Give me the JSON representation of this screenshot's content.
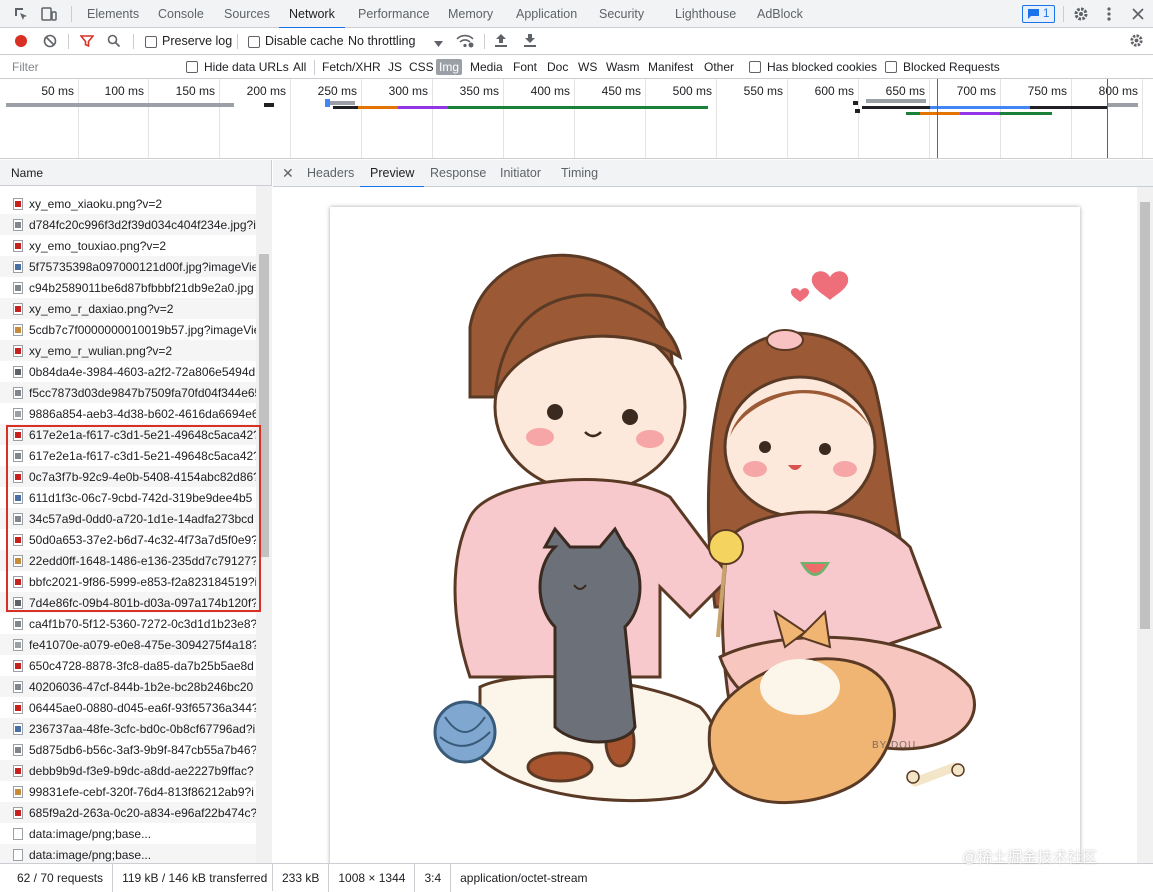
{
  "main_tabs": [
    "Elements",
    "Console",
    "Sources",
    "Network",
    "Performance",
    "Memory",
    "Application",
    "Security",
    "Lighthouse",
    "AdBlock"
  ],
  "active_main_tab": "Network",
  "message_count": "1",
  "toolbar": {
    "preserve_log": "Preserve log",
    "disable_cache": "Disable cache",
    "throttling": "No throttling"
  },
  "filter": {
    "placeholder": "Filter",
    "hide_data_urls": "Hide data URLs",
    "types": [
      "All",
      "Fetch/XHR",
      "JS",
      "CSS",
      "Img",
      "Media",
      "Font",
      "Doc",
      "WS",
      "Wasm",
      "Manifest",
      "Other"
    ],
    "active_type": "Img",
    "has_blocked_cookies": "Has blocked cookies",
    "blocked_requests": "Blocked Requests"
  },
  "overview": {
    "ticks": [
      "50 ms",
      "100 ms",
      "150 ms",
      "200 ms",
      "250 ms",
      "300 ms",
      "350 ms",
      "400 ms",
      "450 ms",
      "500 ms",
      "550 ms",
      "600 ms",
      "650 ms",
      "700 ms",
      "750 ms",
      "800 ms"
    ]
  },
  "list": {
    "header": "Name",
    "requests": [
      "xy_emo_xiaoku.png?v=2",
      "d784fc20c996f3d2f39d034c404f234e.jpg?i",
      "xy_emo_touxiao.png?v=2",
      "5f75735398a097000121d00f.jpg?imageVie",
      "c94b2589011be6d87bfbbbf21db9e2a0.jpg",
      "xy_emo_r_daxiao.png?v=2",
      "5cdb7c7f0000000010019b57.jpg?imageVie",
      "xy_emo_r_wulian.png?v=2",
      "0b84da4e-3984-4603-a2f2-72a806e5494d",
      "f5cc7873d03de9847b7509fa70fd04f344e65",
      "9886a854-aeb3-4d38-b602-4616da6694e6",
      "617e2e1a-f617-c3d1-5e21-49648c5aca42?",
      "617e2e1a-f617-c3d1-5e21-49648c5aca42?",
      "0c7a3f7b-92c9-4e0b-5408-4154abc82d86?",
      "611d1f3c-06c7-9cbd-742d-319be9dee4b5",
      "34c57a9d-0dd0-a720-1d1e-14adfa273bcd",
      "50d0a653-37e2-b6d7-4c32-4f73a7d5f0e9?",
      "22edd0ff-1648-1486-e136-235dd7c79127?",
      "bbfc2021-9f86-5999-e853-f2a823184519?i",
      "7d4e86fc-09b4-801b-d03a-097a174b120f?",
      "ca4f1b70-5f12-5360-7272-0c3d1d1b23e8?",
      "fe41070e-a079-e0e8-475e-3094275f4a18?",
      "650c4728-8878-3fc8-da85-da7b25b5ae8d",
      "40206036-47cf-844b-1b2e-bc28b246bc20",
      "06445ae0-0880-d045-ea6f-93f65736a344?",
      "236737aa-48fe-3cfc-bd0c-0b8cf67796ad?i",
      "5d875db6-b56c-3af3-9b9f-847cb55a7b46?",
      "debb9b9d-f3e9-b9dc-a8dd-ae2227b9ffac?",
      "99831efe-cebf-320f-76d4-813f86212ab9?i",
      "685f9a2d-263a-0c20-a834-e96af22b474c?i",
      "data:image/png;base...",
      "data:image/png;base..."
    ]
  },
  "detail_tabs": [
    "Headers",
    "Preview",
    "Response",
    "Initiator",
    "Timing"
  ],
  "active_detail_tab": "Preview",
  "preview": {
    "signature": "BY DOU"
  },
  "status_left": [
    "62 / 70 requests",
    "119 kB / 146 kB transferred"
  ],
  "status_right": [
    "233 kB",
    "1008 × 1344",
    "3:4",
    "application/octet-stream"
  ],
  "watermark": "@稀土掘金技术社区",
  "colors": {
    "accent": "#1a73e8",
    "record": "#d93025",
    "highlight": "#d93025"
  }
}
